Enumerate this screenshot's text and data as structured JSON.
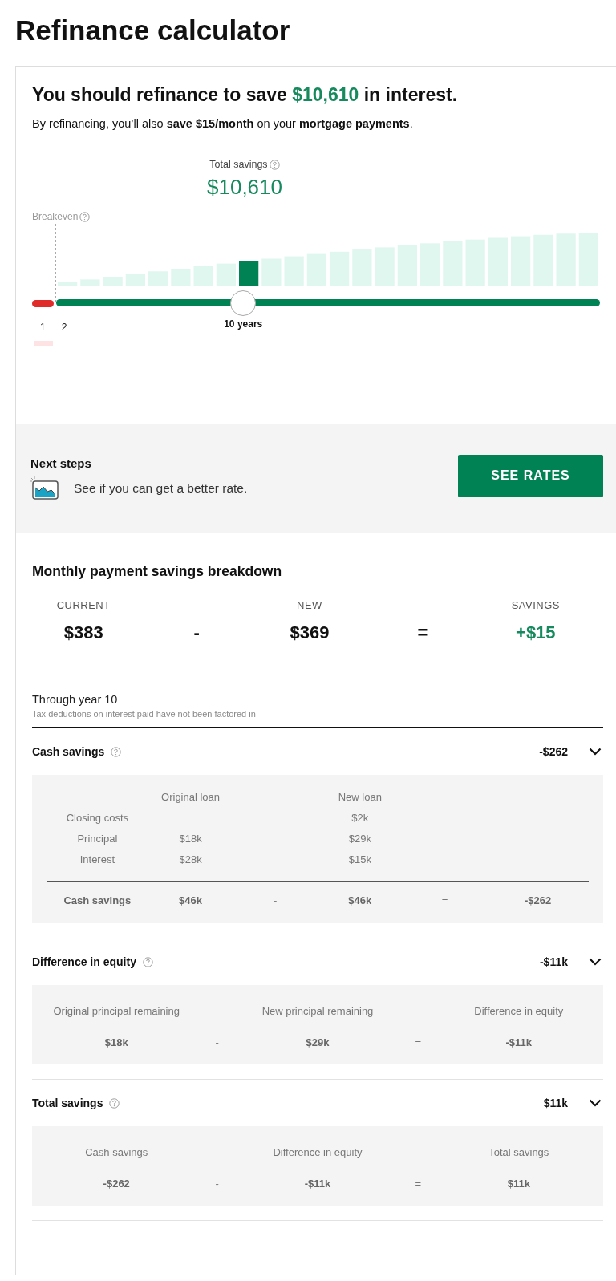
{
  "page_title": "Refinance calculator",
  "result": {
    "headline_before": "You should refinance to save ",
    "headline_amount": "$10,610",
    "headline_after": " in interest.",
    "subtitle": "By refinancing, you’ll also **save $15/month** on your **mortgage payments**."
  },
  "chart": {
    "total_label": "Total savings",
    "total_value": "$10,610",
    "breakeven_label": "Breakeven",
    "bars": [
      {
        "selected": false
      },
      {
        "selected": false
      },
      {
        "selected": false
      },
      {
        "selected": false
      },
      {
        "selected": false
      },
      {
        "selected": false
      },
      {
        "selected": false
      },
      {
        "selected": false
      },
      {
        "selected": true
      },
      {
        "selected": false
      },
      {
        "selected": false
      },
      {
        "selected": false
      },
      {
        "selected": false
      },
      {
        "selected": false
      },
      {
        "selected": false
      },
      {
        "selected": false
      },
      {
        "selected": false
      },
      {
        "selected": false
      },
      {
        "selected": false
      },
      {
        "selected": false
      },
      {
        "selected": false
      },
      {
        "selected": false
      },
      {
        "selected": false
      },
      {
        "selected": false
      }
    ],
    "slider": {
      "level": 0.344,
      "value_label": "10 years"
    },
    "axis_labels": [
      "1",
      "2"
    ]
  },
  "next_steps": {
    "title": "Next steps",
    "text": "See if you can get a better rate.",
    "button": "SEE RATES"
  },
  "monthly": {
    "title": "Monthly payment savings breakdown",
    "items": [
      {
        "kind": "value",
        "label": "CURRENT",
        "value": "$383",
        "highlight": false
      },
      {
        "kind": "operator",
        "value": "-"
      },
      {
        "kind": "value",
        "label": "NEW",
        "value": "$369",
        "highlight": false
      },
      {
        "kind": "operator",
        "value": "="
      },
      {
        "kind": "value",
        "label": "SAVINGS",
        "value": "+$15",
        "highlight": true
      }
    ]
  },
  "period": {
    "title": "Through year 10",
    "note": "Tax deductions on interest paid have not been factored in"
  },
  "sections": [
    {
      "kind": "loan_table",
      "title": "Cash savings",
      "value": "-$262",
      "expanded": true,
      "columns": [
        "Original loan",
        "New loan"
      ],
      "rows": [
        {
          "label": "Closing costs",
          "original": "",
          "new": "$2k"
        },
        {
          "label": "Principal",
          "original": "$18k",
          "new": "$29k"
        },
        {
          "label": "Interest",
          "original": "$28k",
          "new": "$15k"
        }
      ],
      "total": {
        "label": "Cash savings",
        "original": "$46k",
        "minus": "-",
        "new": "$46k",
        "equals": "=",
        "result": "-$262"
      }
    },
    {
      "kind": "equation",
      "title": "Difference in equity",
      "value": "-$11k",
      "expanded": true,
      "terms": [
        {
          "label": "Original principal remaining",
          "value": "$18k"
        },
        {
          "label": "New principal remaining",
          "value": "$29k"
        },
        {
          "label": "Difference in equity",
          "value": "-$11k"
        }
      ],
      "minus": "-",
      "equals": "="
    },
    {
      "kind": "equation",
      "title": "Total savings",
      "value": "$11k",
      "expanded": true,
      "terms": [
        {
          "label": "Cash savings",
          "value": "-$262"
        },
        {
          "label": "Difference in equity",
          "value": "-$11k"
        },
        {
          "label": "Total savings",
          "value": "$11k"
        }
      ],
      "minus": "-",
      "equals": "="
    }
  ]
}
